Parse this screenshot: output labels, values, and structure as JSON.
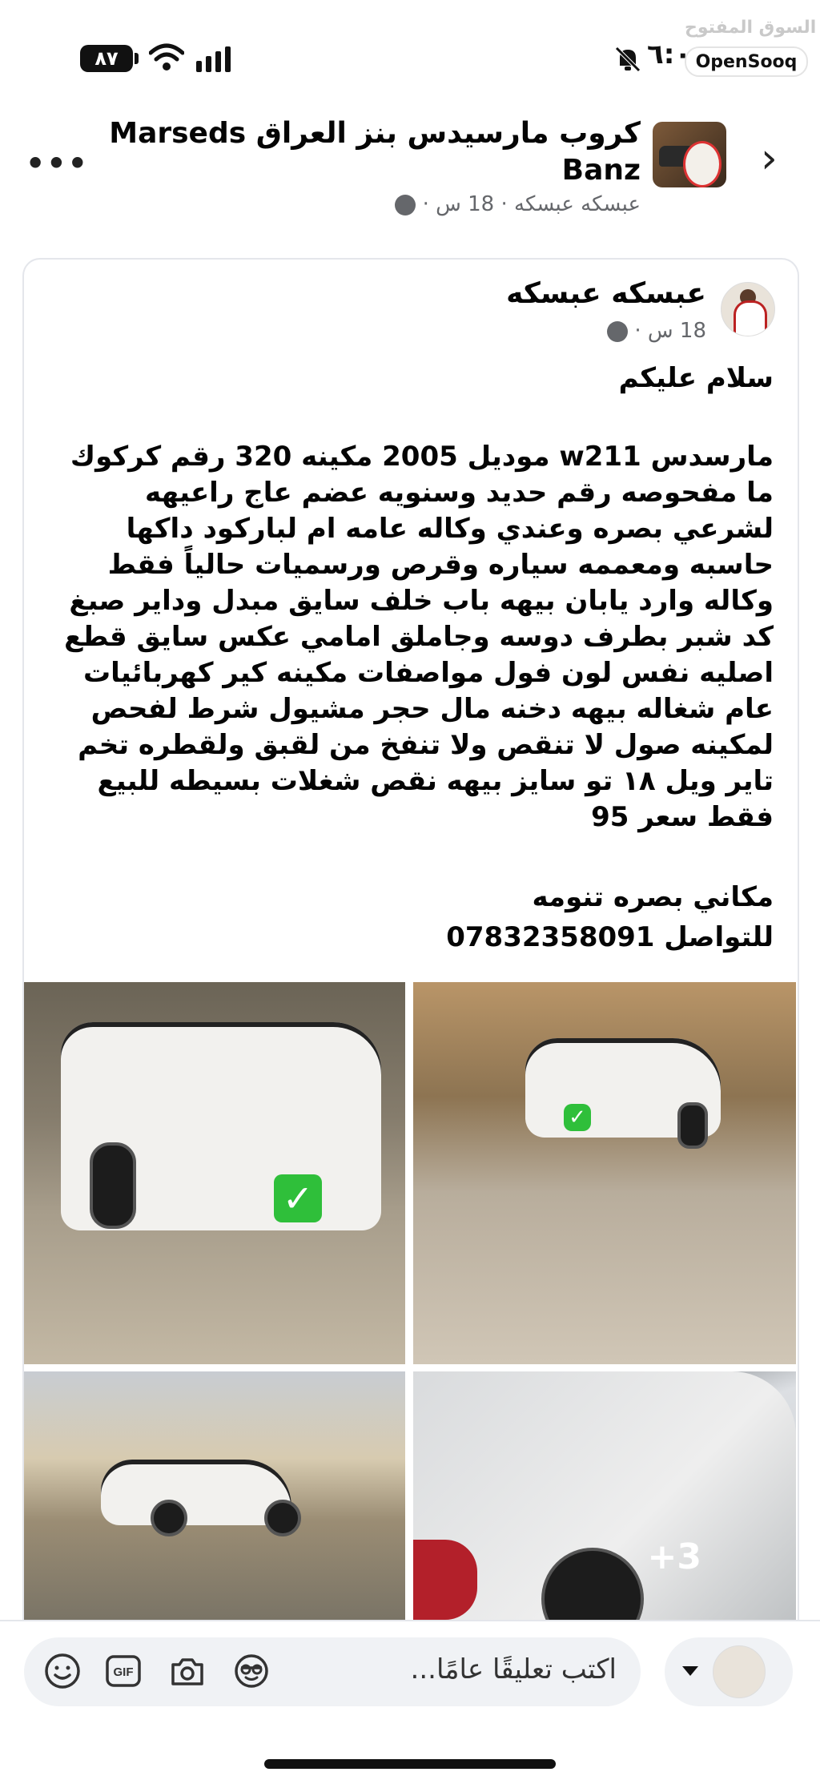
{
  "status_bar": {
    "battery": "٨٧",
    "time": "٦:٠",
    "watermark": "السوق المفتوح",
    "brand_badge": "OpenSooq"
  },
  "group_header": {
    "title": "كروب مارسيدس بنز العراق Marseds Banz",
    "subtitle": "عبسكه عبسكه · 18 س ·"
  },
  "post": {
    "author": "عبسكه عبسكه",
    "meta": "18 س ·",
    "greeting": "سلام عليكم",
    "body": "مارسدس w211 موديل 2005 مكينه 320 رقم كركوك ما مفحوصه رقم حديد وسنويه عضم عاج راعيهه لشرعي بصره وعندي وكاله عامه ام لباركود داكها حاسبه ومعممه سياره وقرص ورسميات حالياً فقط وكاله وارد يابان بيهه باب خلف سايق مبدل وداير صبغ كد شبر بطرف دوسه وجاملق امامي عكس سايق قطع اصليه نفس لون فول مواصفات مكينه كير كهربائيات عام شغاله بيهه دخنه مال حجر مشيول شرط لفحص لمكينه صول لا تنقص ولا تنفخ من لقبق ولقطره تخم تاير ويل ١٨ تو سايز بيهه نقص شغلات بسيطه للبيع فقط سعر 95",
    "location": "مكاني بصره تنومه",
    "contact": "للتواصل 07832358091",
    "more_photos": "+3"
  },
  "comment_bar": {
    "placeholder": "اكتب تعليقًا عامًا..."
  },
  "icons": [
    "battery-icon",
    "wifi-icon",
    "signal-icon",
    "bell-muted-icon",
    "back-chevron-icon",
    "more-icon",
    "globe-icon",
    "emoji-icon",
    "gif-icon",
    "camera-icon",
    "sticker-icon",
    "caret-down-icon"
  ],
  "colors": {
    "text": "#050505",
    "meta": "#65676b",
    "pill_bg": "#f0f2f5",
    "check_green": "#2fbf3a"
  }
}
